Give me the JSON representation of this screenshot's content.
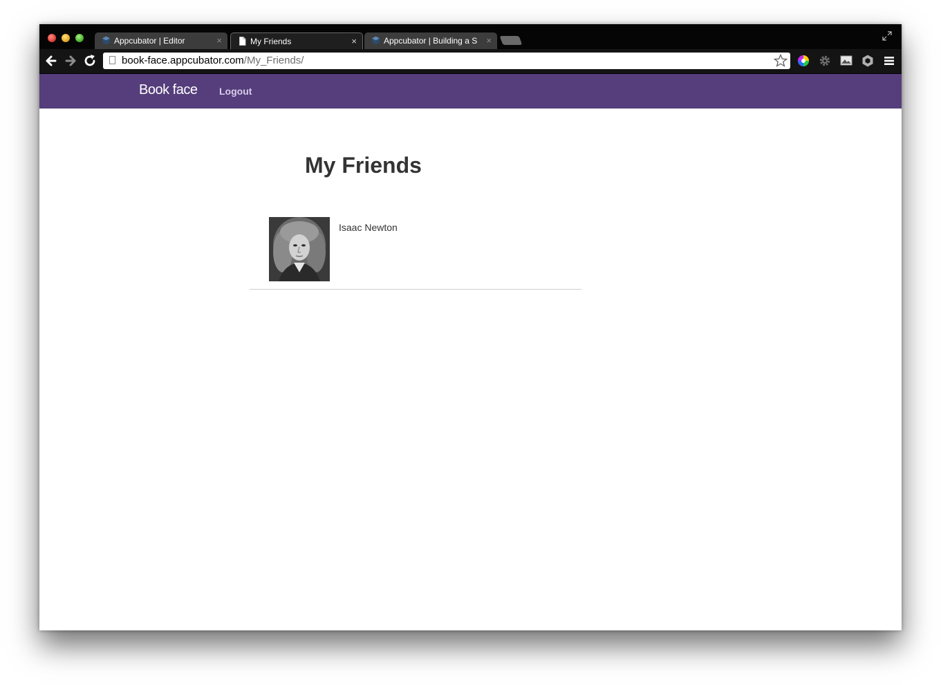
{
  "browser": {
    "tabs": [
      {
        "title": "Appcubator | Editor",
        "active": false,
        "favicon": "appcubator-icon"
      },
      {
        "title": "My Friends",
        "active": true,
        "favicon": "page-icon"
      },
      {
        "title": "Appcubator | Building a So",
        "active": false,
        "favicon": "appcubator-icon"
      }
    ],
    "close_glyph": "×",
    "url_host": "book-face.appcubator.com",
    "url_path": "/My_Friends/",
    "nav_icons": [
      "back-arrow-icon",
      "forward-arrow-icon",
      "reload-icon"
    ],
    "extension_icons": [
      "color-wheel-icon",
      "gear-icon",
      "image-icon",
      "hexagon-icon",
      "menu-icon"
    ]
  },
  "app": {
    "brand": "Book face",
    "nav_links": [
      "Logout"
    ],
    "brand_color": "#553e7b"
  },
  "main": {
    "title": "My Friends",
    "friends": [
      {
        "name": "Isaac Newton",
        "photo": "portrait-photo"
      }
    ]
  }
}
